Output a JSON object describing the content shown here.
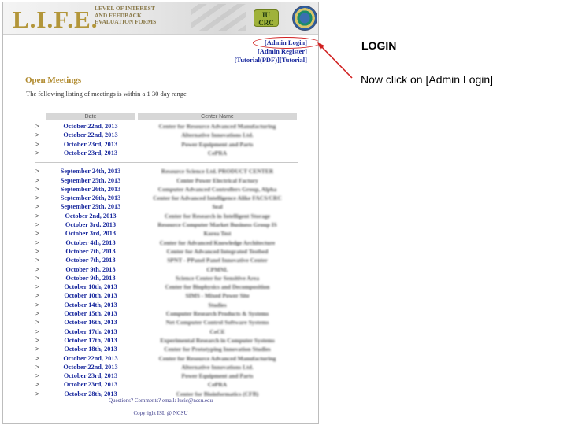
{
  "header": {
    "logo": "L.I.F.E.",
    "tagline": [
      "LEVEL OF INTEREST",
      "AND FEEDBACK",
      "EVALUATION FORMS"
    ],
    "badge": [
      "IU",
      "CRC"
    ]
  },
  "links": {
    "admin_login": "[Admin Login]",
    "admin_register": "[Admin Register]",
    "tutorial_pdf": "[Tutorial(PDF)]",
    "tutorial": "[Tutorial]"
  },
  "section": {
    "title": "Open Meetings",
    "intro": "The following listing of meetings is within a 1 30 day range"
  },
  "table": {
    "headers": {
      "date": "Date",
      "center": "Center Name"
    },
    "group1": [
      {
        "date": "October 22nd, 2013",
        "center": "Center for Resource Advanced Manufacturing"
      },
      {
        "date": "October 22nd, 2013",
        "center": "Alternative Innovations Ltd."
      },
      {
        "date": "October 23rd, 2013",
        "center": "Power Equipment and Parts"
      },
      {
        "date": "October 23rd, 2013",
        "center": "CePRA"
      }
    ],
    "group2": [
      {
        "date": "September 24th, 2013",
        "center": "Resource Science Ltd. PRODUCT CENTER"
      },
      {
        "date": "September 25th, 2013",
        "center": "Center Power Electrical Factory"
      },
      {
        "date": "September 26th, 2013",
        "center": "Computer Advanced Controllers Group, Alpha"
      },
      {
        "date": "September 26th, 2013",
        "center": "Center for Advanced Intelligence Alike FACS/CRC"
      },
      {
        "date": "September 29th, 2013",
        "center": "Seal"
      },
      {
        "date": "October 2nd, 2013",
        "center": "Center for Research in Intelligent Storage"
      },
      {
        "date": "October 3rd, 2013",
        "center": "Resource Computer Market Business Group IS"
      },
      {
        "date": "October 3rd, 2013",
        "center": "Korea Test"
      },
      {
        "date": "October 4th, 2013",
        "center": "Center for Advanced Knowledge Architecture"
      },
      {
        "date": "October 7th, 2013",
        "center": "Center for Advanced Integrated Testbed"
      },
      {
        "date": "October 7th, 2013",
        "center": "SPNT - PPanel Panel Innovative Center"
      },
      {
        "date": "October 9th, 2013",
        "center": "CPMNL"
      },
      {
        "date": "October 9th, 2013",
        "center": "Science Center for Sensitive Area"
      },
      {
        "date": "October 10th, 2013",
        "center": "Center for Biophysics and Decomposition"
      },
      {
        "date": "October 10th, 2013",
        "center": "SIMS - Mixed Power Site"
      },
      {
        "date": "October 14th, 2013",
        "center": "Studies"
      },
      {
        "date": "October 15th, 2013",
        "center": "Computer Research Products & Systems"
      },
      {
        "date": "October 16th, 2013",
        "center": "Net Computer Control Software Systems"
      },
      {
        "date": "October 17th, 2013",
        "center": "CeCE"
      },
      {
        "date": "October 17th, 2013",
        "center": "Experimental Research in Computer Systems"
      },
      {
        "date": "October 18th, 2013",
        "center": "Center for Prototyping Innovation Studies"
      },
      {
        "date": "October 22nd, 2013",
        "center": "Center for Resource Advanced Manufacturing"
      },
      {
        "date": "October 22nd, 2013",
        "center": "Alternative Innovations Ltd."
      },
      {
        "date": "October 23rd, 2013",
        "center": "Power Equipment and Parts"
      },
      {
        "date": "October 23rd, 2013",
        "center": "CePRA"
      },
      {
        "date": "October 28th, 2013",
        "center": "Center for Bioinformatics (CFB)"
      }
    ]
  },
  "footer": {
    "line1": "Questions? Comments? email: lucic@ncsu.edu",
    "line2": "Copyright ISL @ NCSU"
  },
  "annotation": {
    "title": "LOGIN",
    "text": "Now click on [Admin Login]",
    "color": "#d02020"
  }
}
